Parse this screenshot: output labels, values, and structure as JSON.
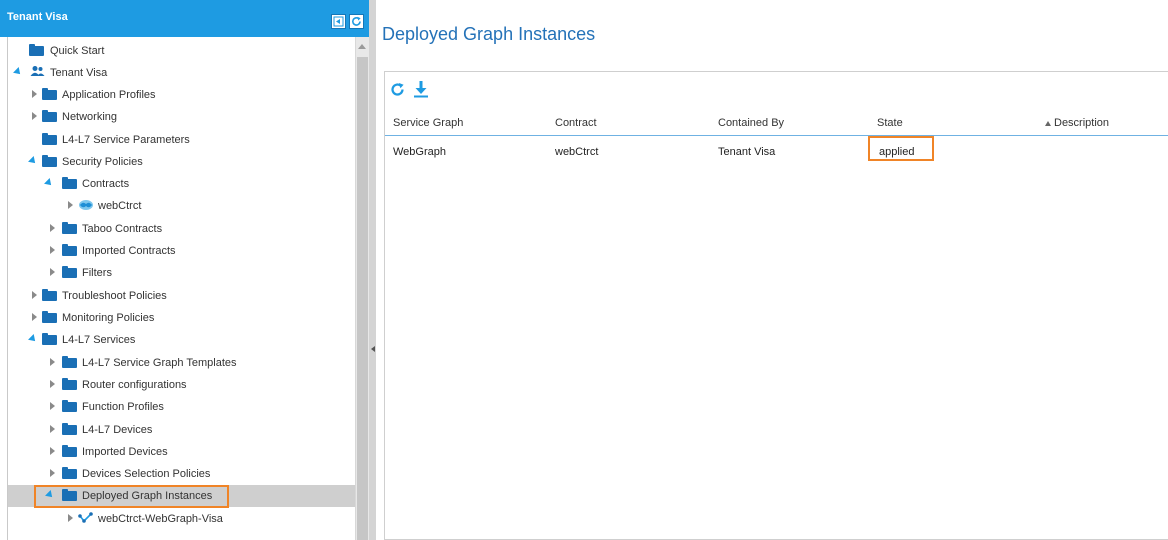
{
  "left_panel": {
    "title": "Tenant Visa",
    "header_icons": [
      "collapse-icon",
      "refresh-icon"
    ],
    "tree": [
      {
        "label": "Quick Start"
      },
      {
        "label": "Tenant Visa"
      },
      {
        "label": "Application Profiles"
      },
      {
        "label": "Networking"
      },
      {
        "label": "L4-L7 Service Parameters"
      },
      {
        "label": "Security Policies"
      },
      {
        "label": "Contracts"
      },
      {
        "label": "webCtrct"
      },
      {
        "label": "Taboo Contracts"
      },
      {
        "label": "Imported Contracts"
      },
      {
        "label": "Filters"
      },
      {
        "label": "Troubleshoot Policies"
      },
      {
        "label": "Monitoring Policies"
      },
      {
        "label": "L4-L7 Services"
      },
      {
        "label": "L4-L7 Service Graph Templates"
      },
      {
        "label": "Router configurations"
      },
      {
        "label": "Function Profiles"
      },
      {
        "label": "L4-L7 Devices"
      },
      {
        "label": "Imported Devices"
      },
      {
        "label": "Devices Selection Policies"
      },
      {
        "label": "Deployed Graph Instances"
      },
      {
        "label": "webCtrct-WebGraph-Visa"
      }
    ],
    "selected_item": "Deployed Graph Instances"
  },
  "main": {
    "title": "Deployed Graph Instances",
    "toolbar_icons": [
      "refresh-icon",
      "download-icon"
    ],
    "columns": [
      "Service Graph",
      "Contract",
      "Contained By",
      "State",
      "Description"
    ],
    "sorted_column": "Description",
    "rows": [
      {
        "service_graph": "WebGraph",
        "contract": "webCtrct",
        "contained_by": "Tenant Visa",
        "state": "applied",
        "description": ""
      }
    ]
  },
  "colors": {
    "header_blue": "#1e9be2",
    "folder_blue": "#1a6fb5",
    "title_blue": "#2472b8",
    "highlight_orange": "#f08427",
    "selected_row": "#cfcfcf"
  }
}
